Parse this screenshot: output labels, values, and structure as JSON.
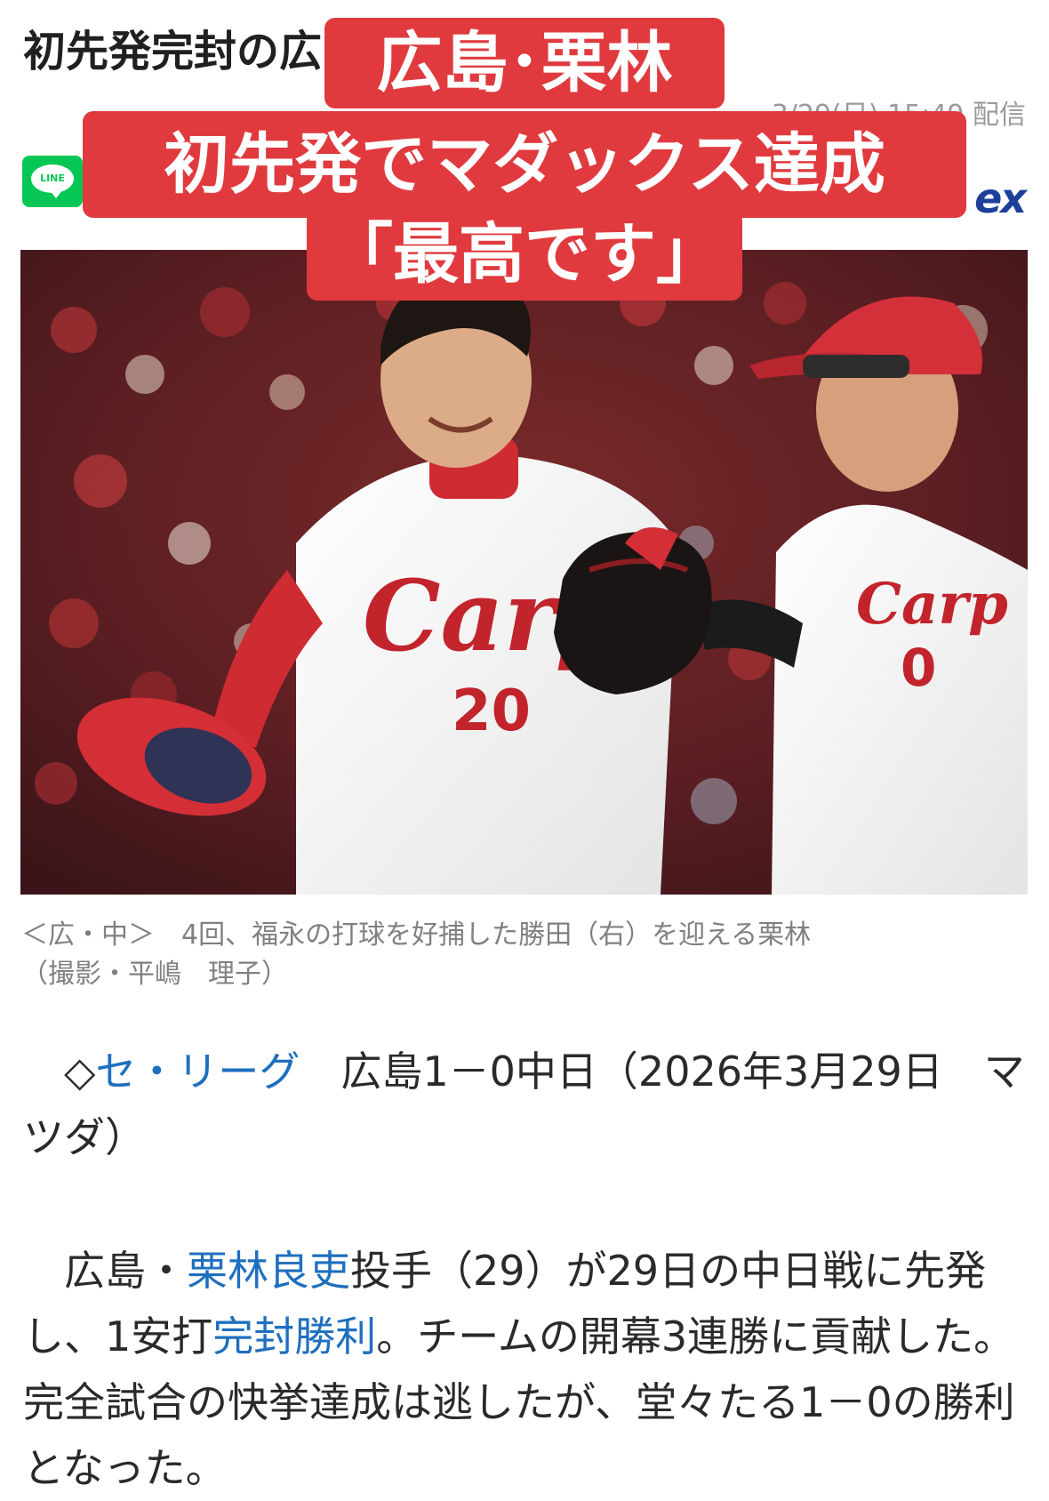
{
  "article": {
    "headline": "初先発完封の広島・栗林「最高です」",
    "pubdate": "3/29(日) 15:49 配信",
    "source_logo": "ex"
  },
  "share": {
    "line_label": "LINE"
  },
  "overlay_banner": {
    "line1": "広島･栗林",
    "line2": "初先発でマダックス達成",
    "line3": "「最高です」",
    "color": "#e03a3f"
  },
  "photo": {
    "jersey_wordmark": "Carp",
    "player_left_number": "20",
    "player_right_number": "0"
  },
  "caption": {
    "line1": "＜広・中＞　4回、福永の打球を好捕した勝田（右）を迎える栗林",
    "line2": "（撮影・平嶋　理子）"
  },
  "body": {
    "p1_prefix": "　◇",
    "p1_link": "セ・リーグ",
    "p1_text": "　広島1－0中日（2026年3月29日　マツダ）",
    "p2_prefix": "　広島・",
    "p2_link1": "栗林良吏",
    "p2_mid": "投手（29）が29日の中日戦に先発し、1安打",
    "p2_link2": "完封勝利",
    "p2_end": "。チームの開幕3連勝に貢献した。完全試合の快挙達成は逃したが、堂々たる1－0の勝利となった。"
  },
  "colors": {
    "link": "#1f6fbf",
    "caption": "#808080",
    "line_green": "#06c755"
  }
}
